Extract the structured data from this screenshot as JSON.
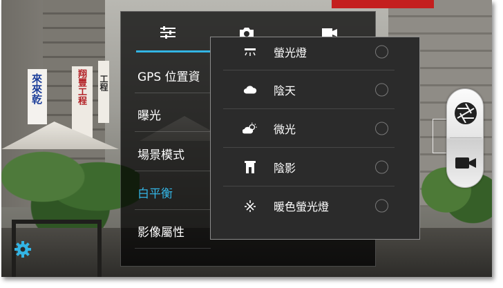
{
  "settings_panel": {
    "tabs": [
      {
        "name": "sliders",
        "icon": "sliders-icon"
      },
      {
        "name": "camera",
        "icon": "camera-icon"
      },
      {
        "name": "video",
        "icon": "video-icon"
      }
    ],
    "active_tab": "sliders",
    "menu": [
      {
        "label": "GPS 位置資",
        "active": false
      },
      {
        "label": "曝光",
        "active": false
      },
      {
        "label": "場景模式",
        "active": false
      },
      {
        "label": "白平衡",
        "active": true
      },
      {
        "label": "影像屬性",
        "active": false
      }
    ]
  },
  "white_balance": {
    "options": [
      {
        "label": "螢光燈",
        "icon": "fluorescent-icon",
        "selected": false
      },
      {
        "label": "陰天",
        "icon": "cloudy-icon",
        "selected": false
      },
      {
        "label": "微光",
        "icon": "twilight-icon",
        "selected": false
      },
      {
        "label": "陰影",
        "icon": "shade-icon",
        "selected": false
      },
      {
        "label": "暖色螢光燈",
        "icon": "warm-fluorescent-icon",
        "selected": false
      }
    ]
  },
  "shutter_control": {
    "photo_icon": "shutter-aperture-icon",
    "video_icon": "video-camera-icon"
  },
  "scene": {
    "sign_left": "來來乾",
    "sign_mid": "翔豐工程",
    "sign_right": "工程"
  },
  "colors": {
    "accent": "#33b5e5",
    "settings_icon": "#33b5e5"
  }
}
